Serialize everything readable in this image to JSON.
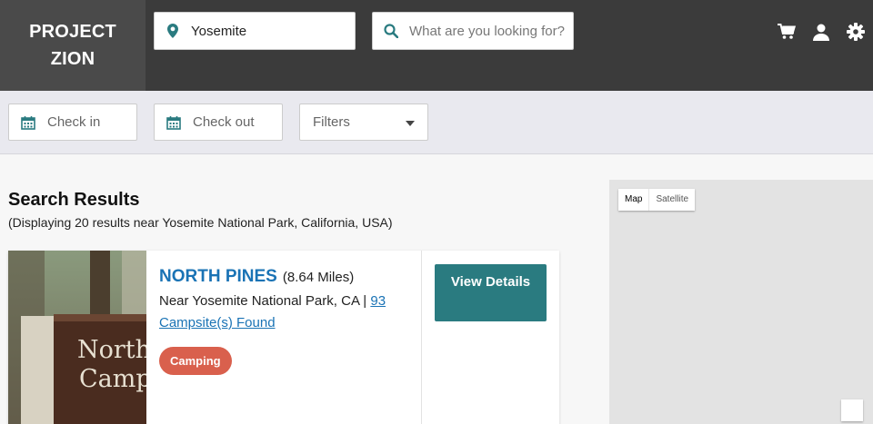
{
  "header": {
    "logo_line1": "PROJECT",
    "logo_line2": "ZION",
    "location_value": "Yosemite",
    "search_placeholder": "What are you looking for?"
  },
  "filters": {
    "check_in": "Check in",
    "check_out": "Check out",
    "filters_label": "Filters"
  },
  "results": {
    "title": "Search Results",
    "subtitle": "(Displaying 20 results near Yosemite National Park, California, USA)",
    "items": [
      {
        "name": "NORTH PINES",
        "distance": "(8.64 Miles)",
        "location": "Near Yosemite National Park, CA |",
        "campsites_link": "93 Campsite(s) Found",
        "badge": "Camping",
        "button": "View Details",
        "image_sign_text": "North Pines Campground"
      }
    ]
  },
  "map": {
    "map_label": "Map",
    "satellite_label": "Satellite"
  },
  "colors": {
    "header_bg": "#3b3b3b",
    "link_blue": "#1a73b5",
    "button_teal": "#2a7b80",
    "badge_red": "#d9604d"
  },
  "icons": [
    "map-marker-icon",
    "search-icon",
    "cart-icon",
    "user-icon",
    "gear-icon",
    "calendar-icon",
    "caret-down-icon"
  ]
}
